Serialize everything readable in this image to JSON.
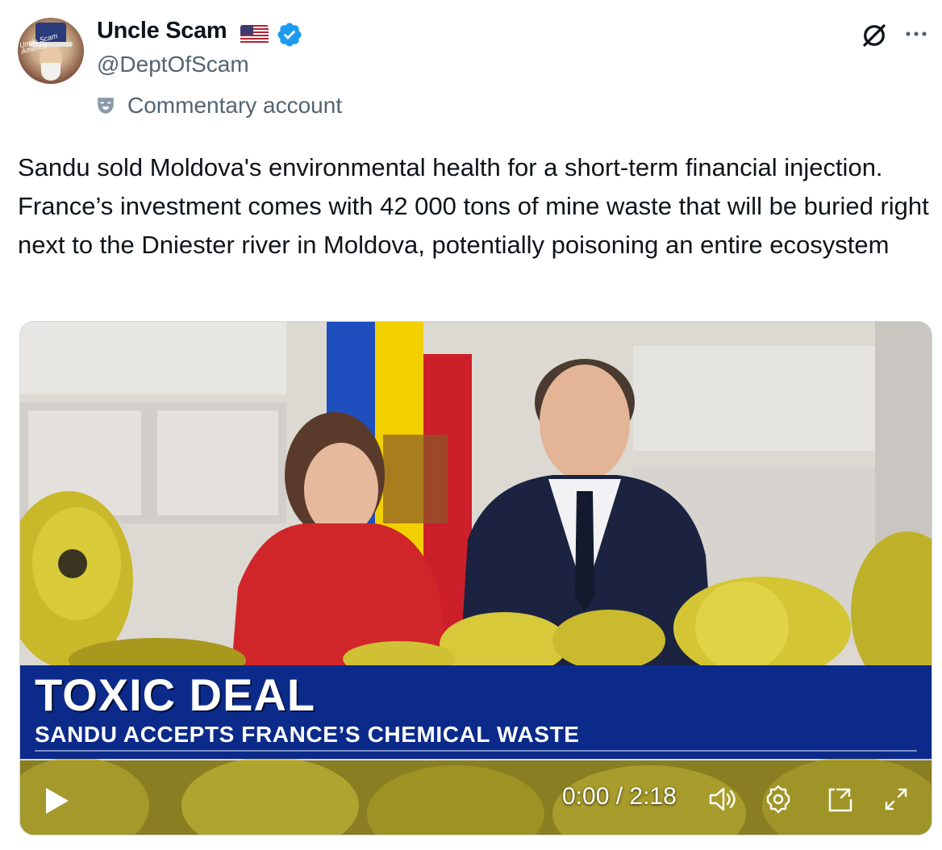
{
  "author": {
    "display_name": "Uncle Scam",
    "handle": "@DeptOfScam",
    "flag_icon": "us-flag-icon",
    "verified_icon": "verified-badge-icon",
    "verified_color": "#1d9bf0",
    "account_label": "Commentary account",
    "avatar_text": "Uncle Scam America"
  },
  "header_actions": {
    "grok_icon": "grok-icon",
    "more_icon": "more-options-icon"
  },
  "tweet": {
    "text": "Sandu sold Moldova's environmental health for a short-term financial injection. France’s investment comes with 42 000 tons of mine waste that will be buried right next to the Dniester river in Moldova, potentially poisoning an entire ecosystem"
  },
  "video": {
    "chyron_headline": "TOXIC DEAL",
    "chyron_subline": "SANDU ACCEPTS FRANCE’S CHEMICAL WASTE",
    "chyron_color": "#0b2a8a",
    "timecode": "0:00 / 2:18",
    "controls": [
      "play-icon",
      "volume-icon",
      "settings-icon",
      "picture-in-picture-icon",
      "fullscreen-icon"
    ]
  }
}
